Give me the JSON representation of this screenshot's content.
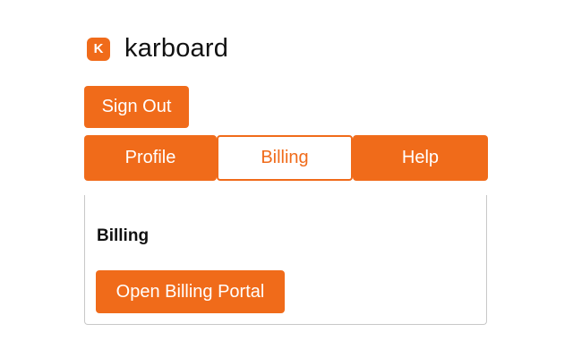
{
  "brand": {
    "logo_letter": "K",
    "name": "karboard",
    "accent_color": "#f06b1a"
  },
  "header": {
    "sign_out_label": "Sign Out"
  },
  "tabs": [
    {
      "label": "Profile",
      "active": false
    },
    {
      "label": "Billing",
      "active": true
    },
    {
      "label": "Help",
      "active": false
    }
  ],
  "panel": {
    "title": "Billing",
    "action_label": "Open Billing Portal"
  }
}
